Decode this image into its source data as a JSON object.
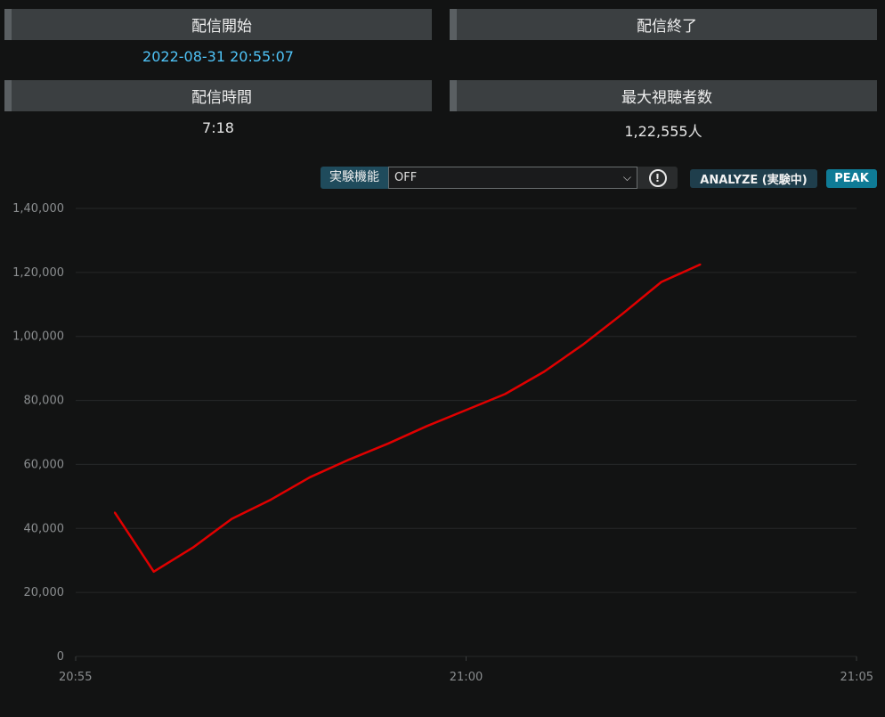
{
  "stats": {
    "start": {
      "label": "配信開始",
      "value": "2022-08-31 20:55:07"
    },
    "end": {
      "label": "配信終了",
      "value": ""
    },
    "duration": {
      "label": "配信時間",
      "value": "7:18"
    },
    "max_viewers": {
      "label": "最大視聴者数",
      "value": "1,22,555人"
    }
  },
  "toolbar": {
    "experimental_label": "実験機能",
    "experimental_value": "OFF",
    "info_icon": "info-circle-icon",
    "analyze_label": "ANALYZE (実験中)",
    "peak_label": "PEAK"
  },
  "colors": {
    "accent": "#4fc3f7",
    "line": "#e00000",
    "peak_button": "#0f7b96"
  },
  "chart_data": {
    "type": "line",
    "x_tick_labels": [
      "20:55",
      "21:00",
      "21:05"
    ],
    "y_tick_labels": [
      "0",
      "20,000",
      "40,000",
      "60,000",
      "80,000",
      "1,00,000",
      "1,20,000",
      "1,40,000"
    ],
    "ylim": [
      0,
      140000
    ],
    "xlim": [
      "20:55",
      "21:05"
    ],
    "grid": true,
    "series": [
      {
        "x": [
          "20:55:30",
          "20:56:00",
          "20:56:30",
          "20:57:00",
          "20:57:30",
          "20:58:00",
          "20:58:30",
          "20:59:00",
          "20:59:30",
          "21:00:00",
          "21:00:30",
          "21:01:00",
          "21:01:30",
          "21:02:00",
          "21:02:30",
          "21:03:00"
        ],
        "values": [
          45000,
          26500,
          34000,
          43000,
          49000,
          56000,
          61500,
          66500,
          72000,
          77000,
          82000,
          89000,
          97500,
          107000,
          117000,
          122500
        ]
      }
    ]
  }
}
